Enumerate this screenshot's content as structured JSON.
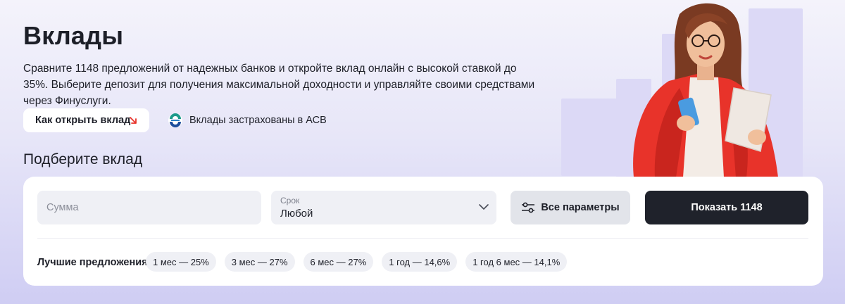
{
  "header": {
    "title": "Вклады",
    "description": "Сравните 1148 предложений от надежных банков и откройте вклад онлайн с высокой ставкой до 35%. Выберите депозит для получения максимальной доходности и управляйте своими средствами через Финуслуги.",
    "how_to_open_label": "Как открыть вклад",
    "insurance_text": "Вклады застрахованы в АСВ"
  },
  "filter": {
    "subtitle": "Подберите вклад",
    "sum_placeholder": "Сумма",
    "term_label": "Срок",
    "term_value": "Любой",
    "params_label": "Все параметры",
    "show_label": "Показать 1148",
    "best_label": "Лучшие предложения",
    "chips": [
      "1 мес — 25%",
      "3 мес — 27%",
      "6 мес — 27%",
      "1 год — 14,6%",
      "1 год 6 мес — 14,1%"
    ]
  },
  "icons": {
    "arrow": "arrow-down-right-icon",
    "asv_logo": "asv-logo-icon",
    "chevron": "chevron-down-icon",
    "sliders": "sliders-icon"
  },
  "colors": {
    "accent_red": "#e8332a",
    "dark_button": "#1f222b",
    "field_bg": "#eff0f5"
  }
}
